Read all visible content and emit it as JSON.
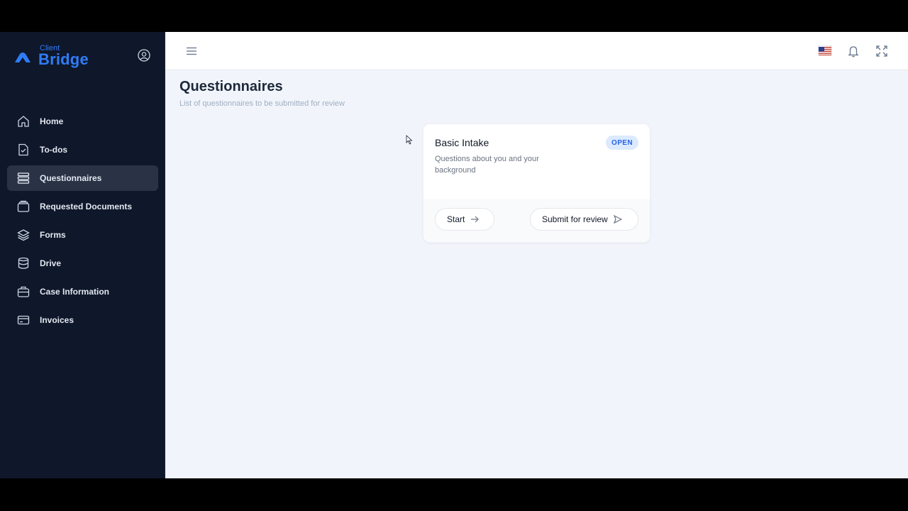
{
  "brand": {
    "small": "Client",
    "big": "Bridge"
  },
  "sidebar": {
    "items": [
      {
        "label": "Home",
        "icon": "home-icon",
        "active": false
      },
      {
        "label": "To-dos",
        "icon": "todo-icon",
        "active": false
      },
      {
        "label": "Questionnaires",
        "icon": "list-icon",
        "active": true
      },
      {
        "label": "Requested Documents",
        "icon": "folder-icon",
        "active": false
      },
      {
        "label": "Forms",
        "icon": "layers-icon",
        "active": false
      },
      {
        "label": "Drive",
        "icon": "database-icon",
        "active": false
      },
      {
        "label": "Case Information",
        "icon": "briefcase-icon",
        "active": false
      },
      {
        "label": "Invoices",
        "icon": "card-icon",
        "active": false
      }
    ]
  },
  "page": {
    "title": "Questionnaires",
    "subtitle": "List of questionnaires to be submitted for review"
  },
  "card": {
    "title": "Basic Intake",
    "description": "Questions about you and your background",
    "status": "OPEN",
    "start_label": "Start",
    "submit_label": "Submit for review"
  },
  "colors": {
    "sidebar_bg": "#0f172a",
    "accent": "#2f7cf6",
    "badge_bg": "#dbeafe",
    "badge_text": "#2563eb"
  }
}
